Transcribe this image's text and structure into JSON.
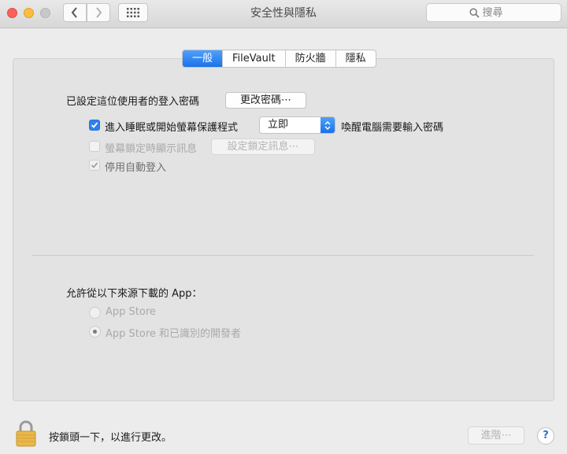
{
  "window": {
    "title": "安全性與隱私",
    "search_placeholder": "搜尋"
  },
  "tabs": [
    {
      "label": "一般",
      "active": true
    },
    {
      "label": "FileVault",
      "active": false
    },
    {
      "label": "防火牆",
      "active": false
    },
    {
      "label": "隱私",
      "active": false
    }
  ],
  "general": {
    "password_label": "已設定這位使用者的登入密碼",
    "change_password_button": "更改密碼⋯",
    "require_password": {
      "checked": true,
      "label": "進入睡眠或開始螢幕保護程式",
      "select_value": "立即",
      "suffix": "喚醒電腦需要輸入密碼"
    },
    "show_message": {
      "checked": false,
      "label": "螢幕鎖定時顯示訊息",
      "button": "設定鎖定訊息⋯"
    },
    "disable_auto_login": {
      "checked": true,
      "label": "停用自動登入"
    }
  },
  "downloads": {
    "label": "允許從以下來源下載的 App：",
    "options": [
      {
        "label": "App Store",
        "selected": false
      },
      {
        "label": "App Store 和已識別的開發者",
        "selected": true
      }
    ]
  },
  "footer": {
    "lock_text": "按鎖頭一下，以進行更改。",
    "advanced_button": "進階⋯",
    "help_button": "?"
  },
  "colors": {
    "accent": "#1b72e8",
    "close": "#fc605c",
    "minimize": "#fdbc40",
    "lock": "#e8b84a"
  }
}
